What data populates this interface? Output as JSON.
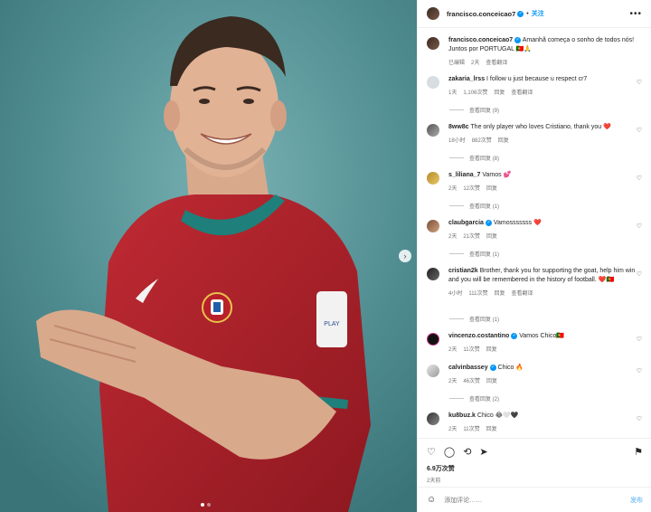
{
  "post": {
    "username": "francisco.conceicao7",
    "follow_label": "关注",
    "more_label": "•••",
    "caption_text": "Amanhã começa o sonho de todos nós! Juntos por PORTUGAL 🇵🇹🙏",
    "caption_meta": {
      "status": "已编辑",
      "time": "2天",
      "translate": "查看翻译"
    },
    "likes": "6.9万次赞",
    "time_ago": "2天前",
    "add_comment_placeholder": "添加评论……",
    "post_button": "发布",
    "carousel_next": "›"
  },
  "icons": {
    "like": "heart-icon",
    "comment": "comment-icon",
    "share": "repost-icon",
    "send": "send-icon",
    "bookmark": "bookmark-icon",
    "emoji": "emoji-icon",
    "verified": "verified-badge-icon"
  },
  "colors": {
    "accent": "#0095f6",
    "heart_red": "#ed4956",
    "jersey_red": "#b3202a",
    "jersey_teal": "#1f7f7a",
    "bg_teal": "#4f8c90"
  },
  "comments": [
    {
      "user": "zakaria_lrss",
      "text": "I follow u just because u respect cr7",
      "time": "1天",
      "likes": "1,106次赞",
      "reply": "回复",
      "translate": "查看翻译",
      "view_replies": "查看回复 (9)"
    },
    {
      "user": "8ww8c",
      "text": "The only player who loves Cristiano, thank you ❤️",
      "time": "18小时",
      "likes": "882次赞",
      "reply": "回复",
      "view_replies": "查看回复 (8)"
    },
    {
      "user": "s_liliana_7",
      "text": "Vamos 💕",
      "time": "2天",
      "likes": "12次赞",
      "reply": "回复",
      "view_replies": "查看回复 (1)"
    },
    {
      "user": "claubgarcia",
      "text": "Vamosssssss ❤️",
      "time": "2天",
      "likes": "21次赞",
      "reply": "回复",
      "view_replies": "查看回复 (1)"
    },
    {
      "user": "cristian2k",
      "text": "Brother, thank you for supporting the goat, help him win and you will be remembered in the history of football. ❤️🇵🇹",
      "time": "4小时",
      "likes": "111次赞",
      "reply": "回复",
      "translate": "查看翻译",
      "view_replies": "查看回复 (1)"
    },
    {
      "user": "vincenzo.costantino",
      "text": "Vamos Chico🇵🇹",
      "time": "2天",
      "likes": "11次赞",
      "reply": "回复"
    },
    {
      "user": "calvinbassey",
      "text": "Chico 🔥",
      "time": "2天",
      "likes": "46次赞",
      "reply": "回复",
      "view_replies": "查看回复 (2)"
    },
    {
      "user": "ku8buz.k",
      "text": "Chico 😂🤍🖤",
      "time": "2天",
      "likes": "11次赞",
      "reply": "回复"
    }
  ]
}
